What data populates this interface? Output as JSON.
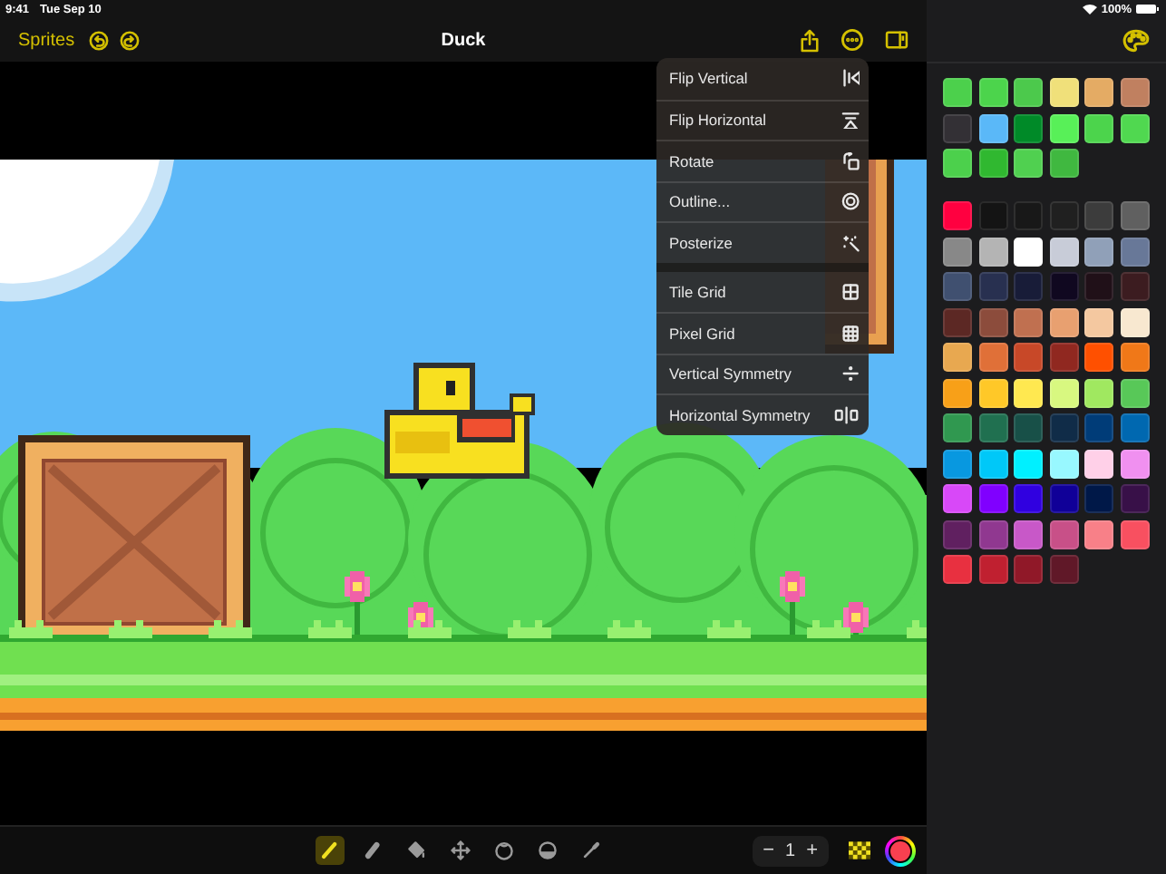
{
  "status_bar": {
    "time": "9:41",
    "date": "Tue Sep 10",
    "battery": "100%"
  },
  "nav_bar": {
    "back_label": "Sprites",
    "title": "Duck"
  },
  "menu": {
    "groups": [
      {
        "items": [
          {
            "label": "Flip Vertical",
            "kind": "flip-vertical"
          },
          {
            "label": "Flip Horizontal",
            "kind": "flip-horizontal"
          },
          {
            "label": "Rotate",
            "kind": "rotate"
          },
          {
            "label": "Outline...",
            "kind": "outline"
          },
          {
            "label": "Posterize",
            "kind": "posterize"
          }
        ]
      },
      {
        "items": [
          {
            "label": "Tile Grid",
            "kind": "tile-grid"
          },
          {
            "label": "Pixel Grid",
            "kind": "pixel-grid"
          },
          {
            "label": "Vertical Symmetry",
            "kind": "vertical-symmetry"
          },
          {
            "label": "Horizontal Symmetry",
            "kind": "horizontal-symmetry"
          }
        ]
      }
    ]
  },
  "palette": {
    "groups": [
      {
        "swatches": [
          {
            "color": "#4cd04c"
          },
          {
            "color": "#4cd44c"
          },
          {
            "color": "#4cc94c"
          },
          {
            "color": "#f0e07a"
          },
          {
            "color": "#e4ab64"
          },
          {
            "color": "#c08060"
          },
          {
            "color": "#333035"
          },
          {
            "color": "#5ab8f8"
          },
          {
            "color": "#008a28"
          },
          {
            "color": "#58f058"
          },
          {
            "color": "#4cd44c"
          },
          {
            "color": "#50d850"
          },
          {
            "color": "#4cd04c"
          },
          {
            "color": "#30b830"
          },
          {
            "color": "#50d050"
          },
          {
            "color": "#40b840"
          }
        ]
      },
      {
        "swatches": [
          {
            "color": "#ff0040"
          },
          {
            "color": "#141414"
          },
          {
            "color": "#181818"
          },
          {
            "color": "#202020"
          },
          {
            "color": "#3c3c3c"
          },
          {
            "color": "#606060"
          },
          {
            "color": "#888888"
          },
          {
            "color": "#b4b4b4"
          },
          {
            "color": "#ffffff"
          },
          {
            "color": "#c8ccd8"
          },
          {
            "color": "#90a0b8"
          },
          {
            "color": "#687898"
          },
          {
            "color": "#405070"
          },
          {
            "color": "#283050"
          },
          {
            "color": "#181c38"
          },
          {
            "color": "#100820"
          },
          {
            "color": "#201018"
          },
          {
            "color": "#3c1c20"
          },
          {
            "color": "#5c2824"
          },
          {
            "color": "#8c4c3c"
          },
          {
            "color": "#c07050"
          },
          {
            "color": "#e8a070"
          },
          {
            "color": "#f4c8a0"
          },
          {
            "color": "#f8e8d0"
          },
          {
            "color": "#e8a850"
          },
          {
            "color": "#e07038"
          },
          {
            "color": "#c84828"
          },
          {
            "color": "#902820"
          },
          {
            "color": "#ff5000"
          },
          {
            "color": "#f07818"
          },
          {
            "color": "#f8a018"
          },
          {
            "color": "#ffc828"
          },
          {
            "color": "#ffe850"
          },
          {
            "color": "#d8f880"
          },
          {
            "color": "#a0e860"
          },
          {
            "color": "#58c858"
          },
          {
            "color": "#309850"
          },
          {
            "color": "#207050"
          },
          {
            "color": "#185048"
          },
          {
            "color": "#102c48"
          },
          {
            "color": "#003c78"
          },
          {
            "color": "#0068b0"
          },
          {
            "color": "#0898e0"
          },
          {
            "color": "#00c8f8"
          },
          {
            "color": "#00f0ff"
          },
          {
            "color": "#98f8ff"
          },
          {
            "color": "#ffd0e8"
          },
          {
            "color": "#f090f0"
          },
          {
            "color": "#d848f8"
          },
          {
            "color": "#8000ff"
          },
          {
            "color": "#3000e0"
          },
          {
            "color": "#100098"
          },
          {
            "color": "#001848"
          },
          {
            "color": "#381048"
          },
          {
            "color": "#602060"
          },
          {
            "color": "#903890"
          },
          {
            "color": "#c858c8"
          },
          {
            "color": "#c85088"
          },
          {
            "color": "#f88088"
          },
          {
            "color": "#f85060"
          },
          {
            "color": "#e83040"
          },
          {
            "color": "#c02030"
          },
          {
            "color": "#901828"
          },
          {
            "color": "#601828"
          }
        ]
      }
    ]
  },
  "toolbar": {
    "tools": [
      {
        "kind": "pencil",
        "selected": true
      },
      {
        "kind": "eraser",
        "selected": false
      },
      {
        "kind": "bucket",
        "selected": false
      },
      {
        "kind": "move",
        "selected": false
      },
      {
        "kind": "lasso",
        "selected": false
      },
      {
        "kind": "shape",
        "selected": false
      },
      {
        "kind": "eyedropper",
        "selected": false
      }
    ],
    "brush_size": {
      "decrement": "−",
      "value": "1",
      "increment": "+"
    },
    "current_color": {
      "color": "#f84050"
    }
  }
}
